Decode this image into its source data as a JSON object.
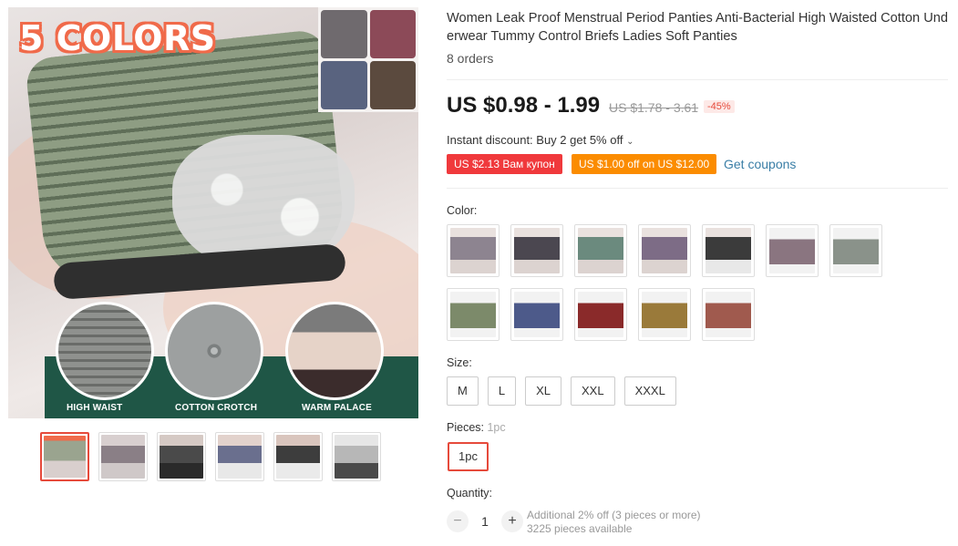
{
  "gallery": {
    "badge_text": "5 COLORS",
    "features": [
      "HIGH WAIST",
      "COTTON CROTCH",
      "WARM PALACE"
    ],
    "thumbnail_colors": [
      "#9aa48f",
      "#8a7f86",
      "#4a4a4a",
      "#6a6f8e",
      "#3d3d3d",
      "#b7b7b7"
    ],
    "active_thumbnail": 0
  },
  "product": {
    "title": "Women Leak Proof Menstrual Period Panties Anti-Bacterial High Waisted Cotton Underwear Tummy Control Briefs Ladies Soft Panties",
    "orders": "8 orders",
    "price": "US $0.98 - 1.99",
    "old_price": "US $1.78 - 3.61",
    "discount": "-45%"
  },
  "promotions": {
    "instant_discount": "Instant discount: Buy 2 get 5% off",
    "coupon_red": "US $2.13 Вам купон",
    "coupon_orange": "US $1.00 off on US $12.00",
    "get_coupons": "Get coupons"
  },
  "color": {
    "label": "Color:",
    "swatches": [
      {
        "color": "#8d8490"
      },
      {
        "color": "#4b4750"
      },
      {
        "color": "#6b8a7e"
      },
      {
        "color": "#7d6c86"
      },
      {
        "color": "#3b3b3b"
      },
      {
        "color": "#8a7580"
      },
      {
        "color": "#8a928a"
      },
      {
        "color": "#7c8a6a"
      },
      {
        "color": "#4d5a8a"
      },
      {
        "color": "#8a2a2a"
      },
      {
        "color": "#9a7a3a"
      },
      {
        "color": "#a05a4e"
      }
    ]
  },
  "size": {
    "label": "Size:",
    "options": [
      "M",
      "L",
      "XL",
      "XXL",
      "XXXL"
    ]
  },
  "pieces": {
    "label": "Pieces:",
    "selected_hint": "1pc",
    "options": [
      "1pc"
    ]
  },
  "quantity": {
    "label": "Quantity:",
    "minus": "−",
    "plus": "+",
    "value": "1",
    "note_line1": "Additional 2% off (3 pieces or more)",
    "note_line2": "3225 pieces available"
  }
}
